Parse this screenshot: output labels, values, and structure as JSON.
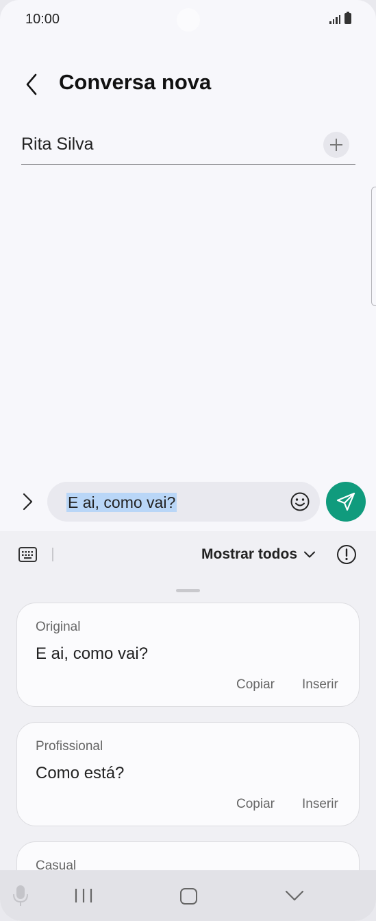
{
  "status_bar": {
    "time": "10:00"
  },
  "header": {
    "title": "Conversa nova"
  },
  "recipient": {
    "name": "Rita Silva"
  },
  "composer": {
    "text": "E ai, como vai?"
  },
  "toolbar": {
    "show_all_label": "Mostrar todos"
  },
  "suggestions": [
    {
      "label": "Original",
      "text": "E ai, como vai?",
      "copy_label": "Copiar",
      "insert_label": "Inserir"
    },
    {
      "label": "Profissional",
      "text": "Como está?",
      "copy_label": "Copiar",
      "insert_label": "Inserir"
    },
    {
      "label": "Casual"
    }
  ],
  "colors": {
    "accent": "#109b7d",
    "selection": "#b9d6f7"
  },
  "icons": [
    "back-icon",
    "plus-icon",
    "chevron-right-icon",
    "emoji-icon",
    "send-icon",
    "keyboard-icon",
    "chevron-down-icon",
    "info-icon",
    "mic-icon",
    "recent-apps-icon",
    "home-icon",
    "nav-back-icon"
  ]
}
